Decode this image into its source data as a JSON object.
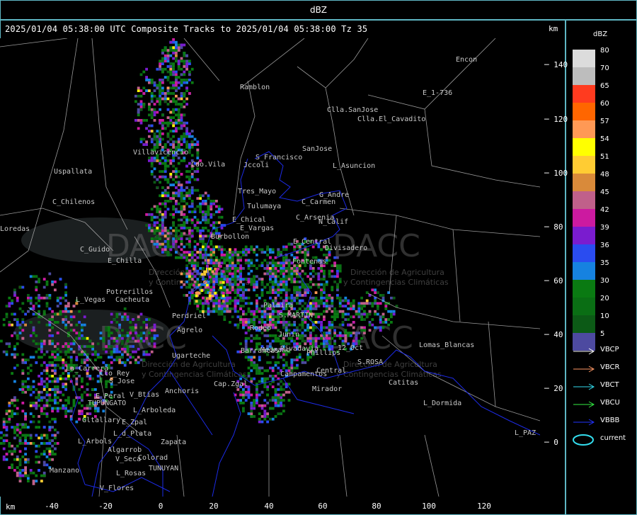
{
  "window": {
    "title": "dBZ"
  },
  "header": {
    "title": "2025/01/04 05:38:00 UTC Composite Tracks to 2025/01/04 05:38:00 Tz 35",
    "km_label": "km"
  },
  "axes": {
    "y_ticks": [
      "140",
      "120",
      "100",
      "80",
      "60",
      "40",
      "20",
      "0"
    ],
    "x_ticks": [
      "-40",
      "-20",
      "0",
      "20",
      "40",
      "60",
      "80",
      "100",
      "120"
    ],
    "x_unit": "km"
  },
  "legend": {
    "title": "dBZ",
    "entries": [
      {
        "value": "80",
        "color": "#dcdcdc"
      },
      {
        "value": "70",
        "color": "#bdbdbd"
      },
      {
        "value": "65",
        "color": "#ff3b1f"
      },
      {
        "value": "60",
        "color": "#ff6600"
      },
      {
        "value": "57",
        "color": "#ff9955"
      },
      {
        "value": "54",
        "color": "#ffff00"
      },
      {
        "value": "51",
        "color": "#ffcc33"
      },
      {
        "value": "48",
        "color": "#d98a3a"
      },
      {
        "value": "45",
        "color": "#c0608a"
      },
      {
        "value": "42",
        "color": "#cc1aa0"
      },
      {
        "value": "39",
        "color": "#7a1ccf"
      },
      {
        "value": "36",
        "color": "#2a4cf0"
      },
      {
        "value": "35",
        "color": "#1682e0"
      },
      {
        "value": "30",
        "color": "#0a7a12"
      },
      {
        "value": "20",
        "color": "#0a6e14"
      },
      {
        "value": "10",
        "color": "#0c5a16"
      },
      {
        "value": "5",
        "color": "#4d4aa0"
      }
    ]
  },
  "tracks": [
    {
      "name": "VBCP",
      "color": "#ffffff"
    },
    {
      "name": "VBCR",
      "color": "#ff9966"
    },
    {
      "name": "VBCT",
      "color": "#33ddee"
    },
    {
      "name": "VBCU",
      "color": "#33ee44"
    },
    {
      "name": "VBBB",
      "color": "#2233ff"
    }
  ],
  "current": {
    "label": "current",
    "color": "#33ddee"
  },
  "watermark": {
    "brand": "DACC",
    "line1": "Dirección de Agricultura",
    "line2": "y Contingencias Climáticas"
  },
  "places": [
    {
      "name": "Encon"
    },
    {
      "name": "Ramblon"
    },
    {
      "name": "Clla.SanJose"
    },
    {
      "name": "Clla.El_Cavadito"
    },
    {
      "name": "E_1-736"
    },
    {
      "name": "Villavicencio"
    },
    {
      "name": "Cdo.Vila"
    },
    {
      "name": "S_Francisco"
    },
    {
      "name": "Jccoli"
    },
    {
      "name": "SanJose"
    },
    {
      "name": "L_Asuncion"
    },
    {
      "name": "Uspallata"
    },
    {
      "name": "Tres_Mayo"
    },
    {
      "name": "G_Andre"
    },
    {
      "name": "Tulumaya"
    },
    {
      "name": "C_Carmen"
    },
    {
      "name": "C_Chilenos"
    },
    {
      "name": "E_Chical"
    },
    {
      "name": "C_Arsenia"
    },
    {
      "name": "E_Vargas"
    },
    {
      "name": "N_Calif"
    },
    {
      "name": "Burbollon"
    },
    {
      "name": "E_Central"
    },
    {
      "name": "Divisadero"
    },
    {
      "name": "C_Guido"
    },
    {
      "name": "E_Chilla"
    },
    {
      "name": "Fontenas"
    },
    {
      "name": "Potrerillos"
    },
    {
      "name": "L_Vegas"
    },
    {
      "name": "Cacheuta"
    },
    {
      "name": "Perdriel"
    },
    {
      "name": "Agrelo"
    },
    {
      "name": "S.MARTIN"
    },
    {
      "name": "Phillips"
    },
    {
      "name": "Ugarteche"
    },
    {
      "name": "12_Oct"
    },
    {
      "name": "Lomas_Blancas"
    },
    {
      "name": "S.ROSA"
    },
    {
      "name": "La_Carrera"
    },
    {
      "name": "Cto_Rey"
    },
    {
      "name": "S_Jose"
    },
    {
      "name": "Campamentos"
    },
    {
      "name": "Central"
    },
    {
      "name": "Catitas"
    },
    {
      "name": "Anchoris"
    },
    {
      "name": "Cap.Zgal"
    },
    {
      "name": "Mirador"
    },
    {
      "name": "E_Peral"
    },
    {
      "name": "V_Btias"
    },
    {
      "name": "TUPUNGATO"
    },
    {
      "name": "L_Arboleda"
    },
    {
      "name": "L_Dormida"
    },
    {
      "name": "Gltallary"
    },
    {
      "name": "E_Zpal"
    },
    {
      "name": "L_d_Plata"
    },
    {
      "name": "L_Arbols"
    },
    {
      "name": "Zapata"
    },
    {
      "name": "L_PAZ"
    },
    {
      "name": "Algarrob"
    },
    {
      "name": "V_Seca"
    },
    {
      "name": "Colorad"
    },
    {
      "name": "Manzano"
    },
    {
      "name": "L_Rosas"
    },
    {
      "name": "TUNUYAN"
    },
    {
      "name": "V_Flores"
    },
    {
      "name": "Loredas"
    },
    {
      "name": "Barrancas"
    },
    {
      "name": "Rivadavia"
    },
    {
      "name": "Junin"
    },
    {
      "name": "Medrano"
    },
    {
      "name": "Rodeo"
    },
    {
      "name": "Palmira"
    }
  ]
}
